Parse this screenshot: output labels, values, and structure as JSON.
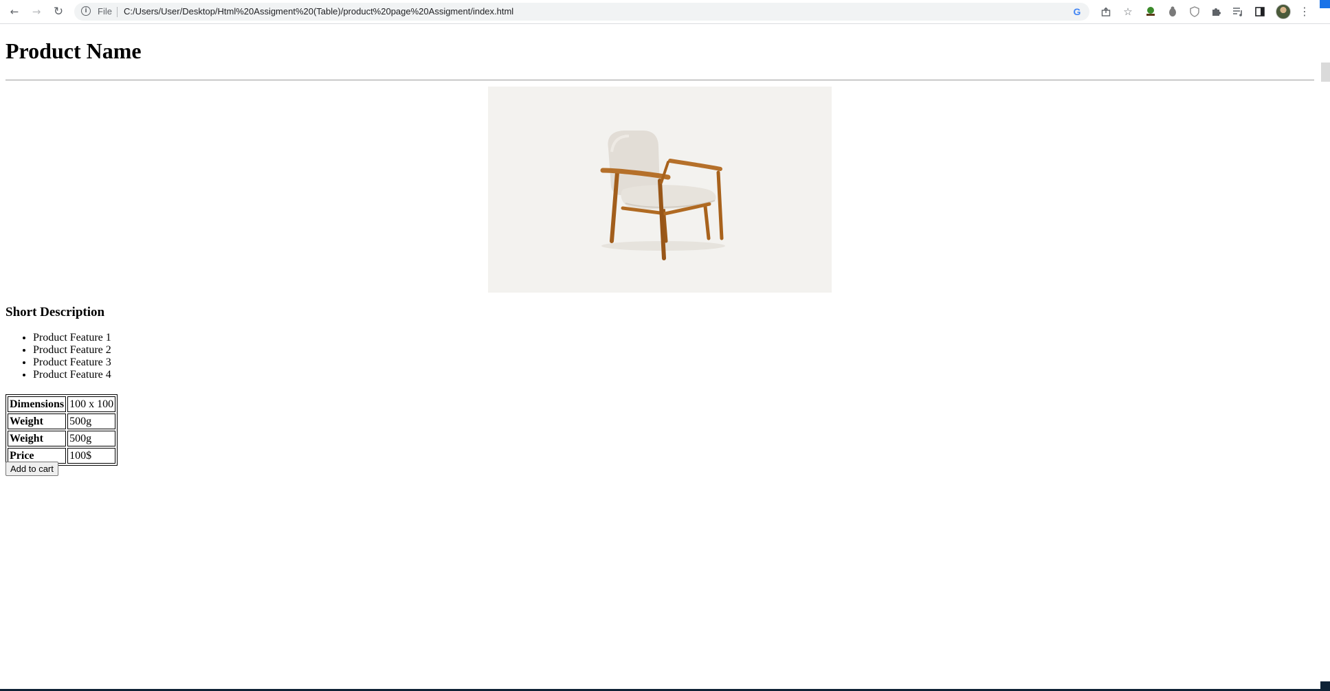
{
  "browser": {
    "nav": {
      "back_icon": "arrow-left-icon",
      "forward_icon": "arrow-right-icon",
      "reload_icon": "reload-icon"
    },
    "address_bar": {
      "scheme_label": "File",
      "url": "C:/Users/User/Desktop/Html%20Assigment%20(Table)/product%20page%20Assigment/index.html"
    },
    "icons": [
      "google-lens-icon",
      "share-icon",
      "bookmark-star-icon",
      "extension-tree-icon",
      "extension-bug-icon",
      "extension-shield-icon",
      "extensions-puzzle-icon",
      "reading-list-icon",
      "side-panel-icon",
      "profile-avatar",
      "menu-kebab-icon"
    ]
  },
  "page": {
    "title": "Product Name",
    "image": {
      "subject": "armchair with wooden frame and light fabric cushions",
      "background_color": "#f3f2ef",
      "wood_color": "#a8621c",
      "fabric_color": "#e2ddd6"
    },
    "short_description_title": "Short Description",
    "features": [
      "Product Feature 1",
      "Product Feature 2",
      "Product Feature 3",
      "Product Feature 4"
    ],
    "specs": [
      {
        "label": "Dimensions",
        "value": "100 x 100"
      },
      {
        "label": "Weight",
        "value": "500g"
      },
      {
        "label": "Weight",
        "value": "500g"
      },
      {
        "label": "Price",
        "value": "100$"
      }
    ],
    "add_to_cart_label": "Add to cart"
  }
}
